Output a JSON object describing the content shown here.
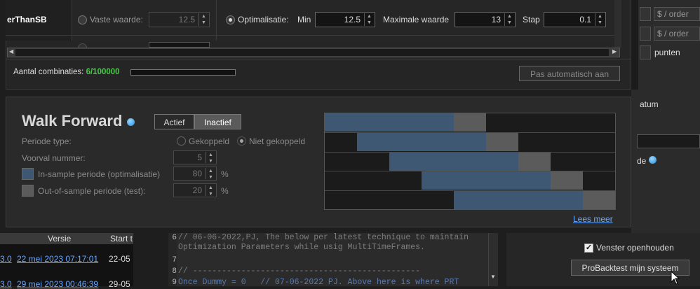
{
  "right_panel": {
    "order_placeholder_1": "$ / order",
    "order_placeholder_2": "$ / order",
    "points_label": "punten",
    "date_label": "atum",
    "info_label": "de"
  },
  "variable_row": {
    "name": "erThanSB",
    "fixed_label": "Vaste waarde:",
    "fixed_value": "12.5",
    "opt_label": "Optimalisatie:",
    "min_label": "Min",
    "min_value": "12.5",
    "max_label": "Maximale waarde",
    "max_value": "13",
    "step_label": "Stap",
    "step_value": "0.1"
  },
  "combinations": {
    "label": "Aantal combinaties:",
    "value": "6/100000",
    "apply_button": "Pas automatisch aan",
    "progress": 0
  },
  "walk_forward": {
    "title": "Walk Forward",
    "toggle_active": "Actief",
    "toggle_inactive": "Inactief",
    "period_type_label": "Periode type:",
    "coupled_label": "Gekoppeld",
    "uncoupled_label": "Niet gekoppeld",
    "index_label": "Voorval nummer:",
    "index_value": "5",
    "in_sample_label": "In-sample periode (optimalisatie)",
    "in_sample_value": "80",
    "out_sample_label": "Out-of-sample periode (test):",
    "out_sample_value": "20",
    "percent_sign": "%",
    "read_more": "Lees meer",
    "colors": {
      "in_sample": "#3e5874",
      "out_of_sample": "#5b5b5b"
    }
  },
  "version_table": {
    "col_version": "Versie",
    "col_start": "Start t",
    "rows": [
      {
        "prefix": "3.0",
        "version": "22 mei 2023 07:17:01",
        "start": "22-05"
      },
      {
        "prefix": "3.0",
        "version": "29 mei 2023 00:46:39",
        "start": "29-05"
      }
    ]
  },
  "editor": {
    "lines": [
      {
        "num": "6",
        "text": "// 06-06-2022,PJ, The below per latest technique to maintain"
      },
      {
        "num": "",
        "text": "Optimization Parameters while usig MultiTimeFrames."
      },
      {
        "num": "7",
        "text": ""
      },
      {
        "num": "8",
        "text": "// -----------------------------------------------"
      },
      {
        "num": "9",
        "text": "Once Dummy = 0   // 07-06-2022 PJ. Above here is where PRT"
      }
    ]
  },
  "footer": {
    "keep_open_label": "Venster openhouden",
    "keep_open_checked": true,
    "run_button": "ProBacktest mijn systeem"
  }
}
